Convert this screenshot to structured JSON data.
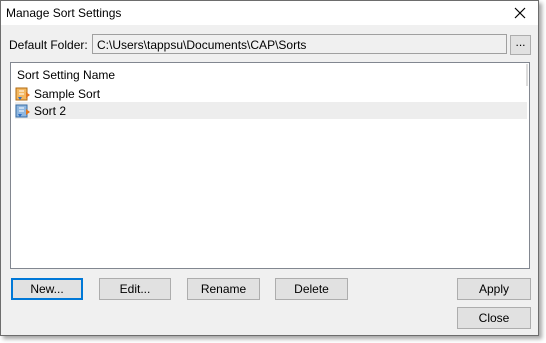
{
  "window": {
    "title": "Manage Sort Settings"
  },
  "folder": {
    "label": "Default Folder:",
    "path": "C:\\Users\\tappsu\\Documents\\CAP\\Sorts",
    "browse_label": "..."
  },
  "list": {
    "header": "Sort Setting Name",
    "items": [
      {
        "label": "Sample Sort",
        "icon": "sort-file-orange-icon",
        "selected": false
      },
      {
        "label": "Sort 2",
        "icon": "sort-file-blue-icon",
        "selected": true
      }
    ]
  },
  "buttons": {
    "new": "New...",
    "edit": "Edit...",
    "rename": "Rename",
    "delete": "Delete",
    "apply": "Apply",
    "close": "Close"
  },
  "colors": {
    "accent": "#0078d7",
    "selection": "#ededed",
    "dialog_bg": "#f0f0f0"
  }
}
